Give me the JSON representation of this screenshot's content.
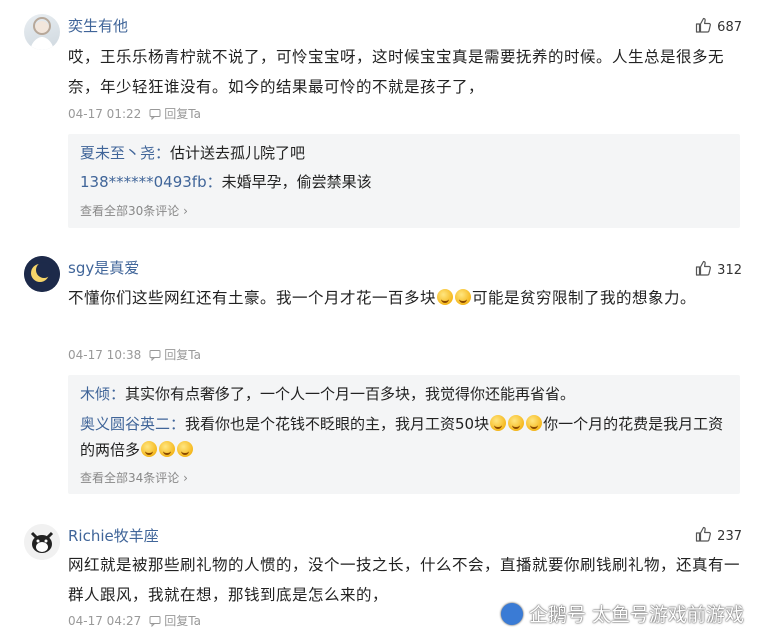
{
  "comments": [
    {
      "username": "奕生有他",
      "likes": "687",
      "content": "哎，王乐乐杨青柠就不说了，可怜宝宝呀，这时候宝宝真是需要抚养的时候。人生总是很多无奈，年少轻狂谁没有。如今的结果最可怜的不就是孩子了，",
      "time": "04-17 01:22",
      "reply_label": "回复Ta",
      "replies": [
        {
          "name": "夏未至丶尧：",
          "text": "估计送去孤儿院了吧"
        },
        {
          "name": "138******0493fb：",
          "text": "未婚早孕，偷尝禁果该"
        }
      ],
      "more": "查看全部30条评论"
    },
    {
      "username": "sgy是真爱",
      "likes": "312",
      "content_a": "不懂你们这些网红还有土豪。我一个月才花一百多块",
      "content_b": "可能是贫穷限制了我的想象力。",
      "time": "04-17 10:38",
      "reply_label": "回复Ta",
      "replies": [
        {
          "name": "木倾：",
          "text": "其实你有点奢侈了，一个人一个月一百多块，我觉得你还能再省省。"
        },
        {
          "name": "奥义圆谷英二：",
          "text_a": "我看你也是个花钱不眨眼的主，我月工资50块",
          "text_b": "你一个月的花费是我月工资的两倍多"
        }
      ],
      "more": "查看全部34条评论"
    },
    {
      "username": "Richie牧羊座",
      "likes": "237",
      "content": "网红就是被那些刷礼物的人惯的，没个一技之长，什么不会，直播就要你刷钱刷礼物，还真有一群人跟风，我就在想，那钱到底是怎么来的，",
      "time": "04-17 04:27",
      "reply_label": "回复Ta"
    }
  ],
  "watermark": "企鹅号 太鱼号游戏前游戏",
  "icons": [
    "thumbs-up-icon",
    "reply-icon",
    "chevron-right-icon",
    "laughing-emoji-icon"
  ],
  "colors": {
    "username": "#406599",
    "meta": "#999999",
    "reply_bg": "#f4f5f6"
  }
}
